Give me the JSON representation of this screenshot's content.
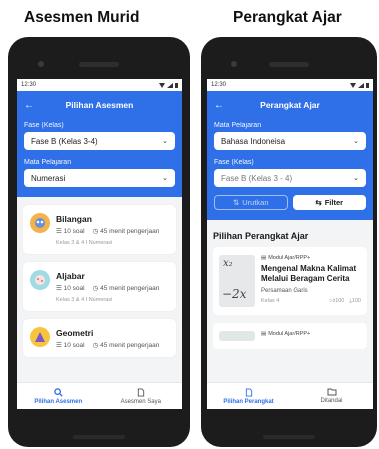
{
  "captions": {
    "left": "Asesmen Murid",
    "right": "Perangkat Ajar"
  },
  "colors": {
    "primary": "#2f6fe8",
    "background": "#f3f4f6"
  },
  "left_screen": {
    "status_time": "12:30",
    "title": "Pilihan Asesmen",
    "back_icon": "arrow-left-icon",
    "fase_label": "Fase (Kelas)",
    "fase_value": "Fase B (Kelas 3-4)",
    "mapel_label": "Mata Pelajaran",
    "mapel_value": "Numerasi",
    "cards": [
      {
        "title": "Bilangan",
        "count": "10 soal",
        "duration": "45 menit pengerjaan",
        "tags": "Kelas 3 & 4  I  Numerasi"
      },
      {
        "title": "Aljabar",
        "count": "10 soal",
        "duration": "45 menit pengerjaan",
        "tags": "Kelas 3 & 4  I  Numerasi"
      },
      {
        "title": "Geometri",
        "count": "10 soal",
        "duration": "45 menit pengerjaan",
        "tags": ""
      }
    ],
    "nav": [
      {
        "label": "Pilihan Asesmen",
        "icon": "search-icon",
        "active": true
      },
      {
        "label": "Asesmen Saya",
        "icon": "document-icon",
        "active": false
      }
    ]
  },
  "right_screen": {
    "status_time": "12:30",
    "title": "Perangkat Ajar",
    "back_icon": "arrow-left-icon",
    "mapel_label": "Mata Pelajaran",
    "mapel_value": "Bahasa Indoneisa",
    "fase_label": "Fase (Kelas)",
    "fase_value": "Fase B (Kelas 3 - 4)",
    "sort_label": "Urutkan",
    "filter_label": "Filter",
    "section_title": "Pilihan Perangkat Ajar",
    "cards": [
      {
        "type": "Modul Ajar/RPP+",
        "title": "Mengenal Makna Kalimat Melalui Beragam Cerita R...",
        "author": "Persamaan Garis",
        "grade": "Kelas 4",
        "likes": "100",
        "downloads": "100",
        "thumb_top": "x₂",
        "thumb_bottom": "−2x"
      },
      {
        "type": "Modul Ajar/RPP+",
        "title": "",
        "author": "",
        "grade": "",
        "likes": "",
        "downloads": ""
      }
    ],
    "nav": [
      {
        "label": "Pilihan Perangkat",
        "icon": "document-icon",
        "active": true
      },
      {
        "label": "Ditandai",
        "icon": "folder-icon",
        "active": false
      }
    ]
  }
}
